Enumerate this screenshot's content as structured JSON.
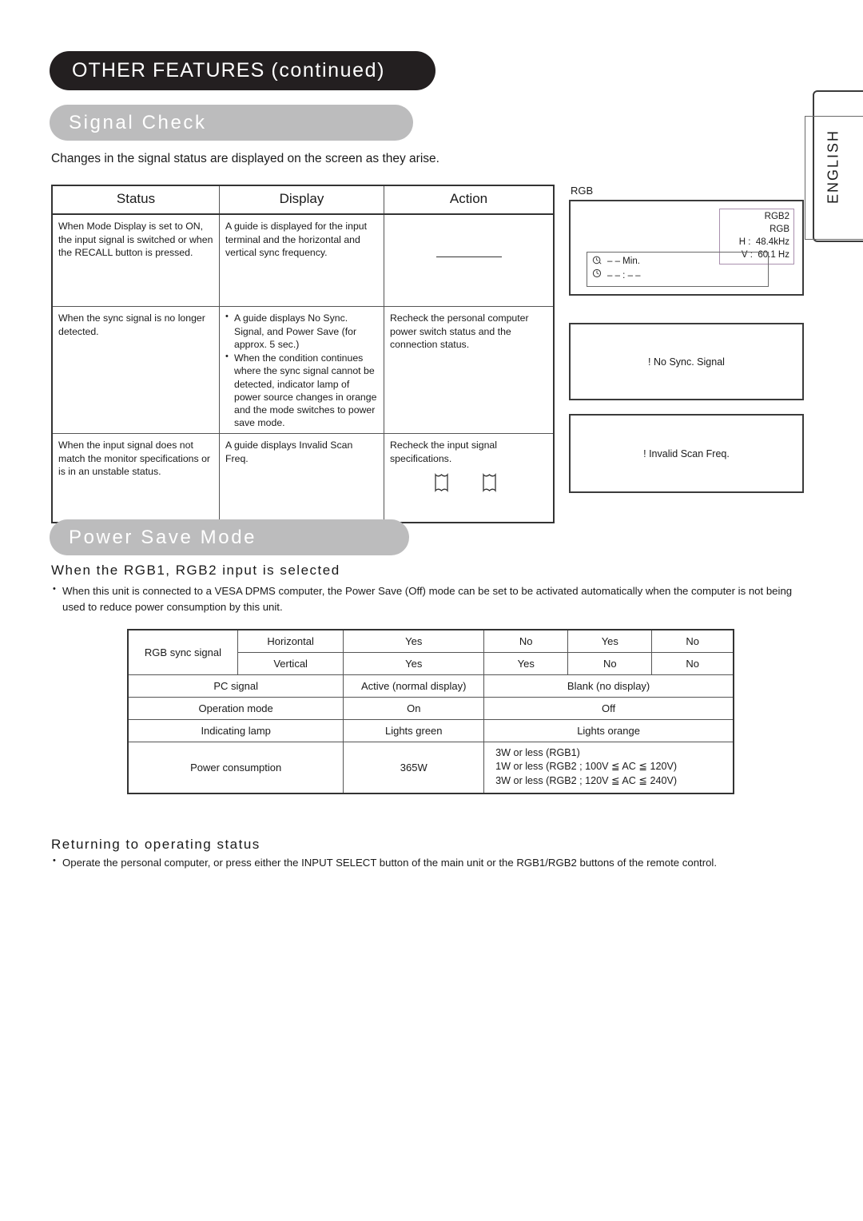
{
  "page": {
    "chapter_banner": "OTHER FEATURES",
    "chapter_banner_suffix": "(continued)",
    "section1_title": "Signal Check",
    "section2_title": "Power Save Mode",
    "language_tab": "ENGLISH"
  },
  "signal_check": {
    "intro": "Changes in the signal status are displayed on the screen as they arise.",
    "headers": [
      "Status",
      "Display",
      "Action"
    ],
    "rows": [
      {
        "status": "When Mode Display is set to ON, the input signal is switched or when the RECALL button is pressed.",
        "display": "A guide is displayed for the input terminal and the horizontal and vertical sync frequency.",
        "action": "",
        "action_kind": "dash"
      },
      {
        "status": "When the sync signal is no longer detected.",
        "display_bullets": [
          "A guide displays No Sync. Signal, and Power Save (for approx. 5 sec.)",
          "When the condition continues where the sync signal cannot be detected, indicator lamp of power source changes in orange and the mode switches to power save mode."
        ],
        "action": "Recheck the personal computer power switch status and the connection status.",
        "action_kind": "text"
      },
      {
        "status": "When the input signal does not match the monitor specifications or is in an unstable status.",
        "display": "A guide displays Invalid Scan Freq.",
        "action": "Recheck the input signal specifications.",
        "action_kind": "text-books"
      }
    ]
  },
  "osd": {
    "rgb_label": "RGB",
    "info": {
      "line1": "RGB2",
      "line2": "RGB",
      "h_label": "H :",
      "h_value": "48.4kHz",
      "v_label": "V :",
      "v_value": "60.1 Hz"
    },
    "timer": {
      "line1": "– –  Min.",
      "line2": "– – : – –"
    },
    "no_sync_message": "! No Sync. Signal",
    "invalid_scan_message": "! Invalid Scan Freq."
  },
  "power_save": {
    "subheading": "When the RGB1, RGB2 input is selected",
    "bullet": "When this unit is connected to a VESA DPMS computer, the Power Save (Off) mode can be set to be activated automatically when the computer is not being used to reduce power consumption by this unit.",
    "table": {
      "rgb_sync_label": "RGB sync signal",
      "horizontal_label": "Horizontal",
      "vertical_label": "Vertical",
      "horizontal_values": [
        "Yes",
        "No",
        "Yes",
        "No"
      ],
      "vertical_values": [
        "Yes",
        "Yes",
        "No",
        "No"
      ],
      "pc_signal_label": "PC signal",
      "pc_signal_on": "Active (normal display)",
      "pc_signal_off": "Blank (no display)",
      "operation_mode_label": "Operation mode",
      "operation_mode_on": "On",
      "operation_mode_off": "Off",
      "indicating_lamp_label": "Indicating lamp",
      "indicating_lamp_on": "Lights green",
      "indicating_lamp_off": "Lights orange",
      "power_consumption_label": "Power consumption",
      "power_consumption_on": "365W",
      "power_consumption_off_1": "3W or less (RGB1)",
      "power_consumption_off_2": "1W or less (RGB2 ; 100V ≦ AC ≦ 120V)",
      "power_consumption_off_3": "3W or less (RGB2 ; 120V ≦ AC ≦ 240V)"
    }
  },
  "returning": {
    "subheading": "Returning to operating status",
    "bullet": "Operate the personal computer, or press either the INPUT SELECT button of the main unit or the RGB1/RGB2 buttons of the remote control."
  }
}
